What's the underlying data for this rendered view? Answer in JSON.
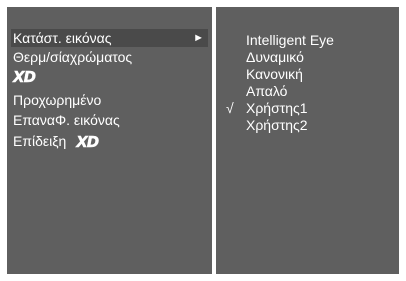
{
  "left_menu": {
    "items": [
      {
        "label": "Κατάστ. εικόνας",
        "arrow": "►"
      },
      {
        "label": "Θερμ/σίαχρώματος"
      },
      {
        "logo": "XD"
      },
      {
        "label": "Προχωρημένο"
      },
      {
        "label": "ΕπαναΦ. εικόνας"
      },
      {
        "label": "Επίδειξη",
        "logo": "XD"
      }
    ]
  },
  "right_menu": {
    "check_mark": "√",
    "items": [
      {
        "label": "Intelligent Eye"
      },
      {
        "label": "Δυναμικό"
      },
      {
        "label": "Κανονική"
      },
      {
        "label": "Απαλό"
      },
      {
        "label": "Χρήστης1"
      },
      {
        "label": "Χρήστης2"
      }
    ]
  },
  "colors": {
    "panel": "#5f5f5f",
    "selected_row": "#4a4a4a",
    "text": "#ffffff",
    "border": "#ffffff"
  }
}
